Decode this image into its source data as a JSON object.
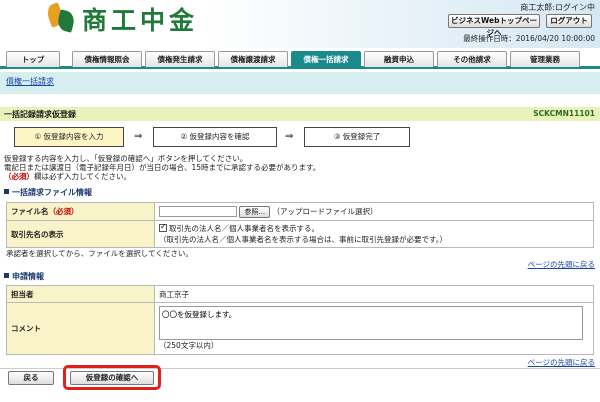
{
  "header": {
    "logo_text": "商工中金",
    "user": "商工太郎:ログイン中",
    "biz_button": "ビジネスWebトップページへ",
    "logout_button": "ログアウト",
    "last_operation": "最終操作日時：2016/04/20 10:00:00"
  },
  "nav": {
    "tabs": [
      {
        "label": "トップ"
      },
      {
        "label": "債権情報照会"
      },
      {
        "label": "債権発生請求"
      },
      {
        "label": "債権譲渡請求"
      },
      {
        "label": "債権一括請求"
      },
      {
        "label": "融資申込"
      },
      {
        "label": "その他請求"
      },
      {
        "label": "管理業務"
      }
    ],
    "active_tab": "債権一括請求",
    "sub_link": "債権一括請求"
  },
  "page": {
    "title": "一括記録請求仮登録",
    "screen_code": "SCKCMN11101"
  },
  "steps": [
    {
      "label": "① 仮登録内容を入力"
    },
    {
      "label": "② 仮登録内容を確認"
    },
    {
      "label": "③ 仮登録完了"
    }
  ],
  "arrow": "⇒",
  "notes": {
    "line1": "仮登録する内容を入力し、「仮登録の確認へ」ボタンを押してください。",
    "line2": "電記日または譲渡日（電子記録年月日）が当日の場合、15時までに承認する必要があります。",
    "line3_req": "（必須）",
    "line3_rest": "欄は必ず入力してください。"
  },
  "file_section": {
    "heading": "一括請求ファイル情報",
    "file_label": "ファイル名",
    "required_mark": "（必須）",
    "browse_button": "参照...",
    "upload_note": "（アップロードファイル選択）",
    "display_label": "取引先名の表示",
    "display_checkbox": "取引先の法人名／個人事業者名を表示する。",
    "display_note": "（取引先の法人名／個人事業者名を表示する場合は、事前に取引先登録が必要です。）",
    "after_note": "承認者を選択してから、ファイルを選択してください。",
    "page_top_link": "ページの先頭に戻る"
  },
  "request_section": {
    "heading": "申請情報",
    "person_label": "担当者",
    "person_value": "商工京子",
    "comment_label": "コメント",
    "comment_value": "〇〇を仮登録します。",
    "char_limit": "（250文字以内）",
    "page_top_link": "ページの先頭に戻る"
  },
  "footer": {
    "back_button": "戻る",
    "confirm_button": "仮登録の確認へ"
  }
}
